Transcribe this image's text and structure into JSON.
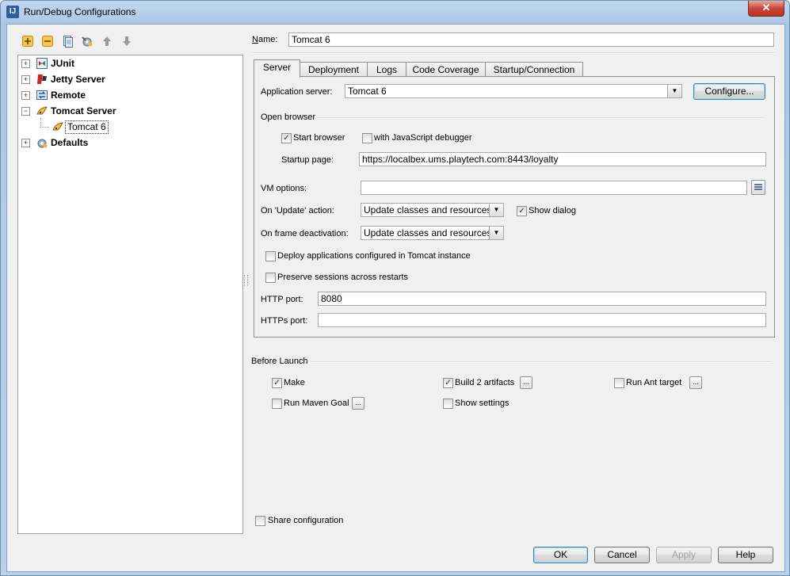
{
  "window": {
    "title": "Run/Debug Configurations",
    "close_glyph": "✕",
    "app_icon": "IJ"
  },
  "toolbar": {
    "icons": [
      "add-icon",
      "remove-icon",
      "copy-icon",
      "settings-icon",
      "move-up-icon",
      "move-down-icon"
    ]
  },
  "tree": {
    "items": [
      {
        "label": "JUnit",
        "expander": "+"
      },
      {
        "label": "Jetty Server",
        "expander": "+"
      },
      {
        "label": "Remote",
        "expander": "+"
      },
      {
        "label": "Tomcat Server",
        "expander": "−"
      },
      {
        "label": "Tomcat 6",
        "expander": ""
      },
      {
        "label": "Defaults",
        "expander": "+"
      }
    ]
  },
  "name": {
    "label": "Name:",
    "value": "Tomcat 6"
  },
  "tabs": [
    "Server",
    "Deployment",
    "Logs",
    "Code Coverage",
    "Startup/Connection"
  ],
  "server": {
    "app_server_label": "Application server:",
    "app_server_value": "Tomcat 6",
    "configure_label": "Configure...",
    "open_browser_label": "Open browser",
    "start_browser_label": "Start browser",
    "js_debugger_label": "with JavaScript debugger",
    "startup_page_label": "Startup page:",
    "startup_page_value": "https://localbex.ums.playtech.com:8443/loyalty",
    "vm_options_label": "VM options:",
    "vm_options_value": "",
    "on_update_label": "On 'Update' action:",
    "on_update_value": "Update classes and resources",
    "show_dialog_label": "Show dialog",
    "on_frame_label": "On frame deactivation:",
    "on_frame_value": "Update classes and resources",
    "deploy_apps_label": "Deploy applications configured in Tomcat instance",
    "preserve_sessions_label": "Preserve sessions across restarts",
    "http_port_label": "HTTP port:",
    "http_port_value": "8080",
    "https_port_label": "HTTPs port:",
    "https_port_value": ""
  },
  "before_launch": {
    "title": "Before Launch",
    "make_label": "Make",
    "build_label": "Build 2 artifacts",
    "ant_label": "Run Ant target",
    "maven_label": "Run Maven Goal",
    "show_settings_label": "Show settings",
    "dots": "..."
  },
  "share_label": "Share configuration",
  "checkmark": "✓",
  "combo_arrow": "▼",
  "buttons": {
    "ok": "OK",
    "cancel": "Cancel",
    "apply": "Apply",
    "help": "Help"
  }
}
